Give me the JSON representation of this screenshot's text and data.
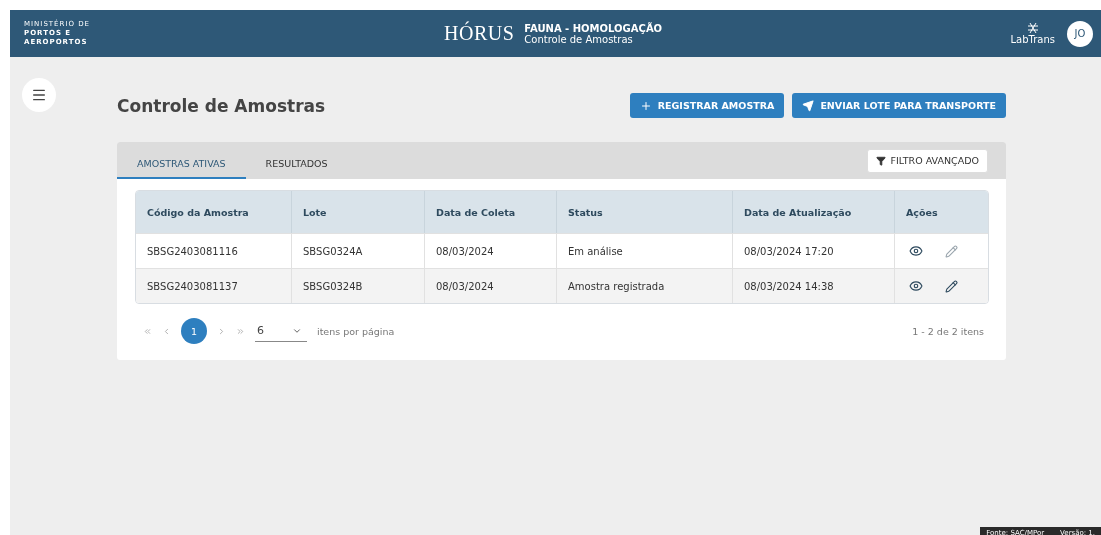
{
  "header": {
    "ministry": [
      "MINISTÉRIO DE",
      "PORTOS E",
      "AEROPORTOS"
    ],
    "logo": "HÓRUS",
    "title": "FAUNA - HOMOLOGAÇÃO",
    "subtitle": "Controle de Amostras",
    "partner": "LabTrans",
    "avatar": "JO"
  },
  "page": {
    "title": "Controle de Amostras",
    "buttons": [
      {
        "kind": "plus",
        "label": "REGISTRAR AMOSTRA"
      },
      {
        "kind": "send",
        "label": "ENVIAR LOTE PARA TRANSPORTE"
      }
    ]
  },
  "tabs": [
    {
      "label": "AMOSTRAS ATIVAS",
      "selected": true
    },
    {
      "label": "RESULTADOS",
      "selected": false
    }
  ],
  "filter_button": "FILTRO AVANÇADO",
  "table": {
    "columns": [
      "Código da Amostra",
      "Lote",
      "Data de Coleta",
      "Status",
      "Data de Atualização",
      "Ações"
    ],
    "rows": [
      {
        "cells": [
          "SBSG2403081116",
          "SBSG0324A",
          "08/03/2024",
          "Em análise",
          "08/03/2024 17:20"
        ],
        "edit_disabled": true
      },
      {
        "cells": [
          "SBSG2403081137",
          "SBSG0324B",
          "08/03/2024",
          "Amostra registrada",
          "08/03/2024 14:38"
        ],
        "edit_disabled": false
      }
    ]
  },
  "pagination": {
    "pages": [
      {
        "label": "1",
        "selected": true
      }
    ],
    "page_size": "6",
    "page_size_label": "itens por página",
    "summary": "1 - 2 de 2 itens"
  },
  "footer": {
    "source": "Fonte: SAC/MPor",
    "version": "Versão: 1."
  }
}
